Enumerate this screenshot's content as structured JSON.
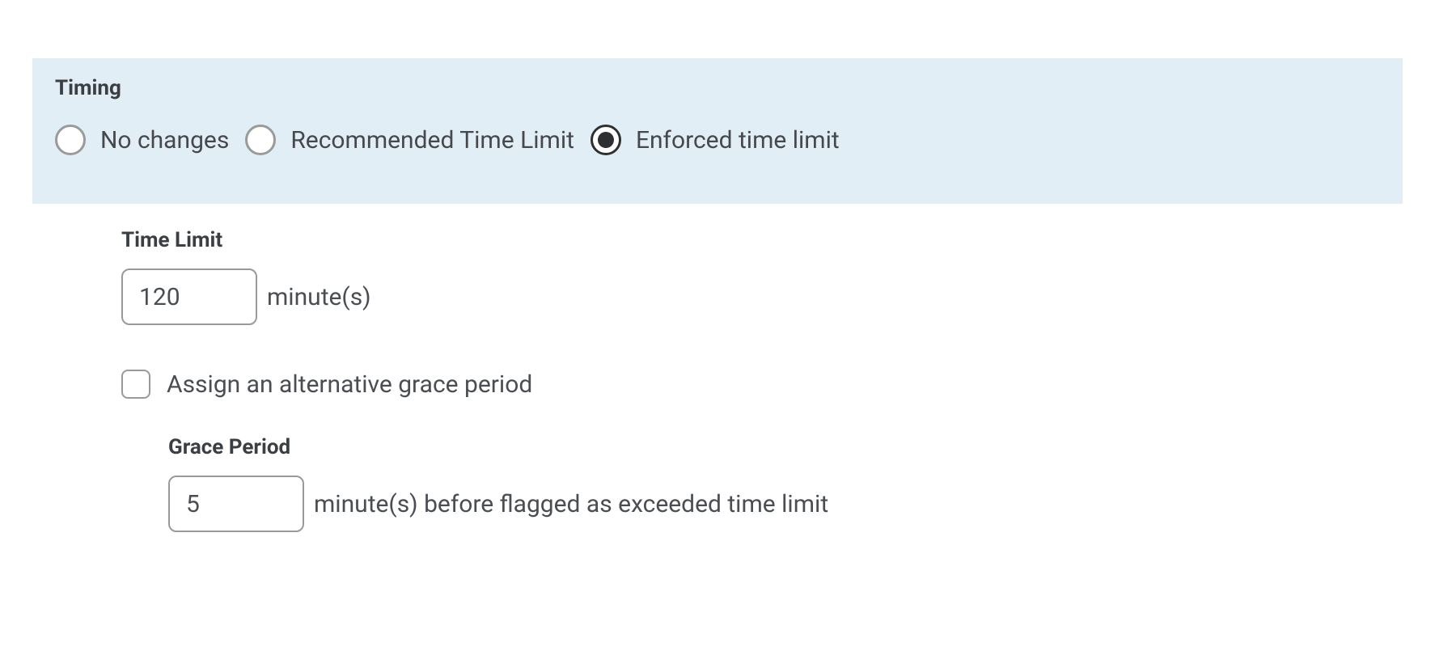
{
  "timing": {
    "heading": "Timing",
    "options": {
      "no_changes": {
        "label": "No changes",
        "selected": false
      },
      "recommended": {
        "label": "Recommended Time Limit",
        "selected": false
      },
      "enforced": {
        "label": "Enforced time limit",
        "selected": true
      }
    },
    "time_limit": {
      "heading": "Time Limit",
      "value": "120",
      "unit": "minute(s)"
    },
    "alt_grace": {
      "checked": false,
      "label": "Assign an alternative grace period"
    },
    "grace_period": {
      "heading": "Grace Period",
      "value": "5",
      "suffix": "minute(s) before flagged as exceeded time limit"
    }
  }
}
